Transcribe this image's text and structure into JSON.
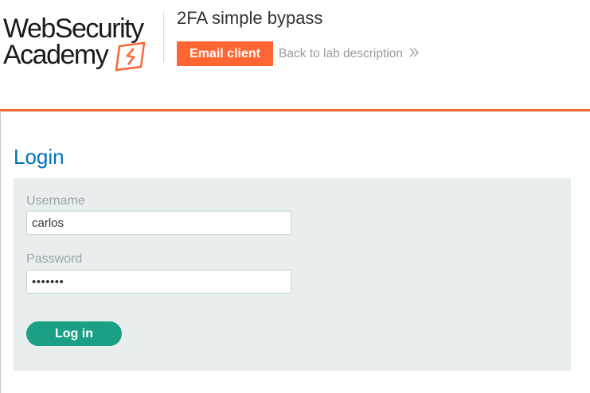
{
  "header": {
    "logo": {
      "line1": "WebSecurity",
      "line2": "Academy",
      "accent_color": "#ff6633"
    },
    "lab_title": "2FA simple bypass",
    "email_client_label": "Email client",
    "back_link_label": "Back to lab description",
    "back_link_icon": "double-chevron-right-icon"
  },
  "main": {
    "heading": "Login",
    "form": {
      "username_label": "Username",
      "username_value": "carlos",
      "password_label": "Password",
      "password_value": "•••••••",
      "submit_label": "Log in"
    }
  },
  "colors": {
    "brand_orange": "#ff6633",
    "heading_blue": "#0071bc",
    "button_green": "#1ba086",
    "panel_bg": "#e8edee"
  }
}
